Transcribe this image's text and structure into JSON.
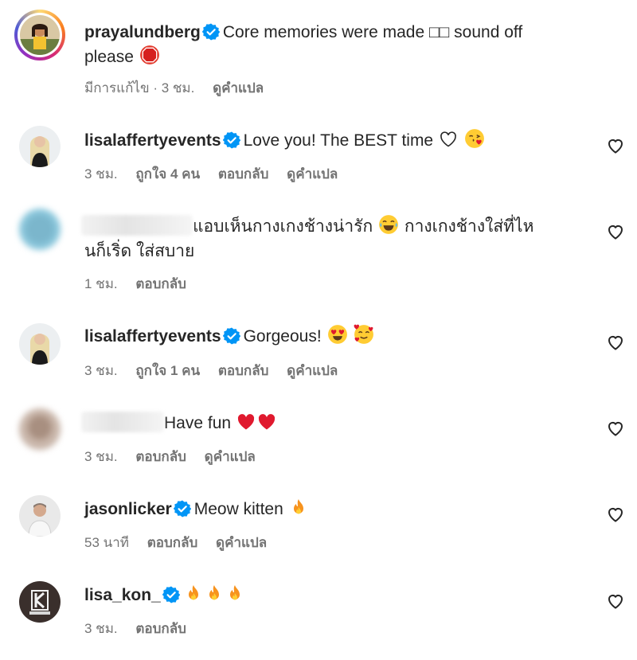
{
  "comments": [
    {
      "username": "prayalundberg",
      "verified": true,
      "text_line1": "Core memories were made □□ sound off",
      "text_line2": "please",
      "meta": {
        "edited": "มีการแก้ไข · 3 ชม.",
        "translate": "ดูคำแปล"
      }
    },
    {
      "username": "lisalaffertyevents",
      "verified": true,
      "text": "Love you! The BEST time",
      "meta": {
        "time": "3 ชม.",
        "likes": "ถูกใจ 4 คน",
        "reply": "ตอบกลับ",
        "translate": "ดูคำแปล"
      }
    },
    {
      "username": "",
      "verified": false,
      "text_line1": "แอบเห็นกางเกงช้างน่ารัก",
      "text_line1b": "กางเกงช้างใส่ที่ไห",
      "text_line2": "นก็เริ่ด ใส่สบาย",
      "meta": {
        "time": "1 ชม.",
        "reply": "ตอบกลับ"
      }
    },
    {
      "username": "lisalaffertyevents",
      "verified": true,
      "text": "Gorgeous!",
      "meta": {
        "time": "3 ชม.",
        "likes": "ถูกใจ 1 คน",
        "reply": "ตอบกลับ",
        "translate": "ดูคำแปล"
      }
    },
    {
      "username": "",
      "verified": false,
      "text": "Have fun",
      "meta": {
        "time": "3 ชม.",
        "reply": "ตอบกลับ",
        "translate": "ดูคำแปล"
      }
    },
    {
      "username": "jasonlicker",
      "verified": true,
      "text": "Meow kitten",
      "meta": {
        "time": "53 นาที",
        "reply": "ตอบกลับ",
        "translate": "ดูคำแปล"
      }
    },
    {
      "username": "lisa_kon_",
      "verified": true,
      "text": "",
      "meta": {
        "time": "3 ชม.",
        "reply": "ตอบกลับ"
      }
    }
  ],
  "icons": {
    "verified": "verified-badge-icon",
    "like": "heart-outline-icon",
    "stop": "stop-sign-emoji",
    "heart_white": "white-heart-emoji",
    "kiss": "face-blowing-kiss-emoji",
    "tears_joy": "face-with-tears-of-joy-emoji",
    "heart_eyes": "heart-eyes-emoji",
    "hearts_face": "smiling-face-with-hearts-emoji",
    "red_heart": "red-heart-emoji",
    "fire": "fire-emoji"
  },
  "colors": {
    "verified": "#0095f6",
    "meta": "#737373",
    "text": "#262626",
    "red_heart": "#e0192e"
  }
}
